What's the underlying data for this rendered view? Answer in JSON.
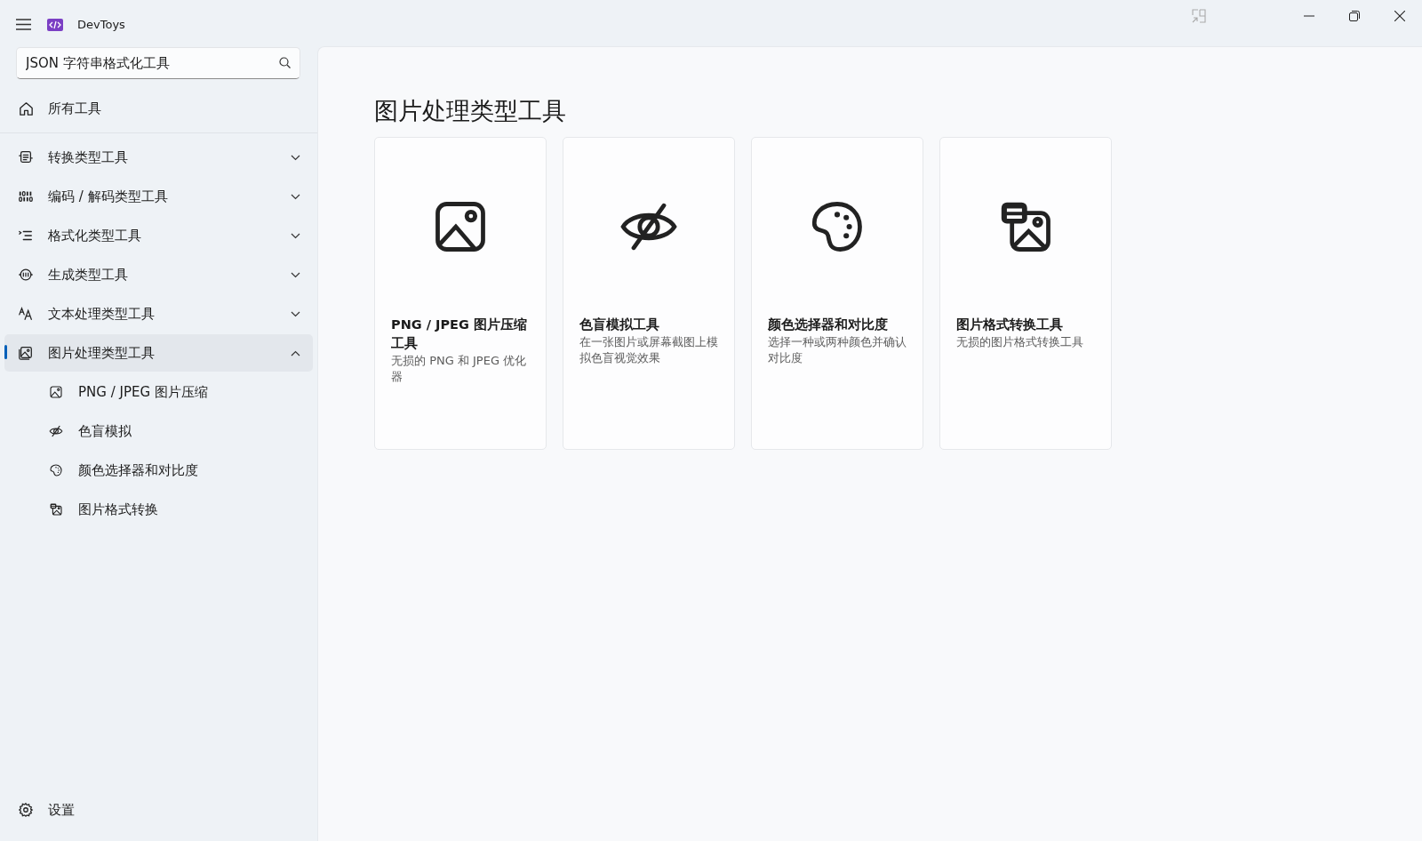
{
  "app": {
    "title": "DevToys"
  },
  "search": {
    "value": "JSON 字符串格式化工具"
  },
  "nav": {
    "home": {
      "label": "所有工具",
      "selected": false
    },
    "categories": [
      {
        "label": "转换类型工具",
        "expanded": false,
        "selected": false
      },
      {
        "label": "编码 / 解码类型工具",
        "expanded": false,
        "selected": false
      },
      {
        "label": "格式化类型工具",
        "expanded": false,
        "selected": false
      },
      {
        "label": "生成类型工具",
        "expanded": false,
        "selected": false
      },
      {
        "label": "文本处理类型工具",
        "expanded": false,
        "selected": false
      },
      {
        "label": "图片处理类型工具",
        "expanded": true,
        "selected": true,
        "children": [
          {
            "label": "PNG / JPEG 图片压缩",
            "selected": false
          },
          {
            "label": "色盲模拟",
            "selected": false
          },
          {
            "label": "颜色选择器和对比度",
            "selected": false
          },
          {
            "label": "图片格式转换",
            "selected": false
          }
        ]
      }
    ],
    "settings": {
      "label": "设置",
      "selected": false
    }
  },
  "page": {
    "heading": "图片处理类型工具",
    "cards": [
      {
        "title": "PNG / JPEG 图片压缩工具",
        "description": "无损的 PNG 和 JPEG 优化器"
      },
      {
        "title": "色盲模拟工具",
        "description": "在一张图片或屏幕截图上模拟色盲视觉效果"
      },
      {
        "title": "颜色选择器和对比度",
        "description": "选择一种或两种颜色并确认对比度"
      },
      {
        "title": "图片格式转换工具",
        "description": "无损的图片格式转换工具"
      }
    ]
  }
}
